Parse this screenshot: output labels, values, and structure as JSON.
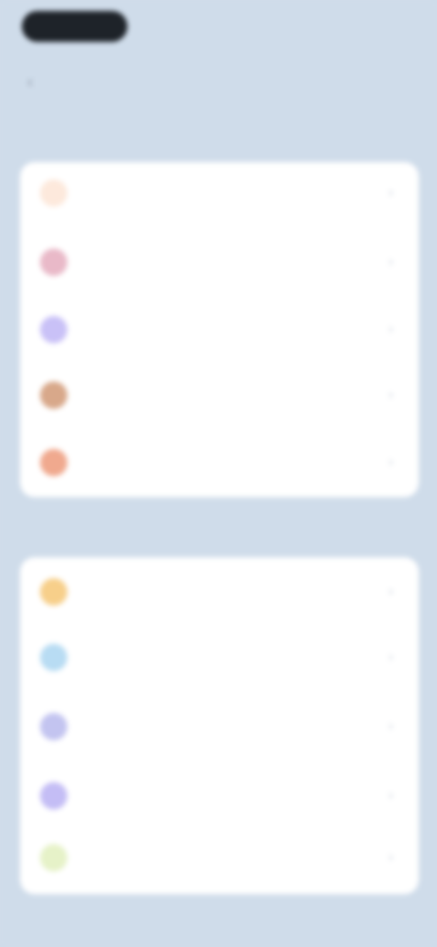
{
  "header": {
    "pill_label": "",
    "back_glyph": "‹"
  },
  "sections": [
    {
      "label": "",
      "items": [
        {
          "label": "",
          "sub": "",
          "icon": "flame-icon",
          "color": "#fde9dc"
        },
        {
          "label": "",
          "sub": "",
          "icon": "heart-icon",
          "color": "#e9b9c8"
        },
        {
          "label": "",
          "sub": "",
          "icon": "crown-icon",
          "color": "#c9c1f7"
        },
        {
          "label": "",
          "sub": "",
          "icon": "gift-icon",
          "color": "#d8a88a"
        },
        {
          "label": "",
          "sub": "",
          "icon": "fire-icon",
          "color": "#f0a98e"
        }
      ]
    },
    {
      "label": "",
      "items": [
        {
          "label": "",
          "sub": "",
          "icon": "star-icon",
          "color": "#f7cf8a"
        },
        {
          "label": "",
          "sub": "",
          "icon": "drop-icon",
          "color": "#b8dcf3"
        },
        {
          "label": "",
          "sub": "",
          "icon": "shield-icon",
          "color": "#c3c4f0"
        },
        {
          "label": "",
          "sub": "",
          "icon": "chat-icon",
          "color": "#c4bdf5"
        },
        {
          "label": "",
          "sub": "",
          "icon": "leaf-icon",
          "color": "#e6f2c8"
        }
      ]
    }
  ],
  "footer": {
    "label": ""
  },
  "chevron": "›"
}
